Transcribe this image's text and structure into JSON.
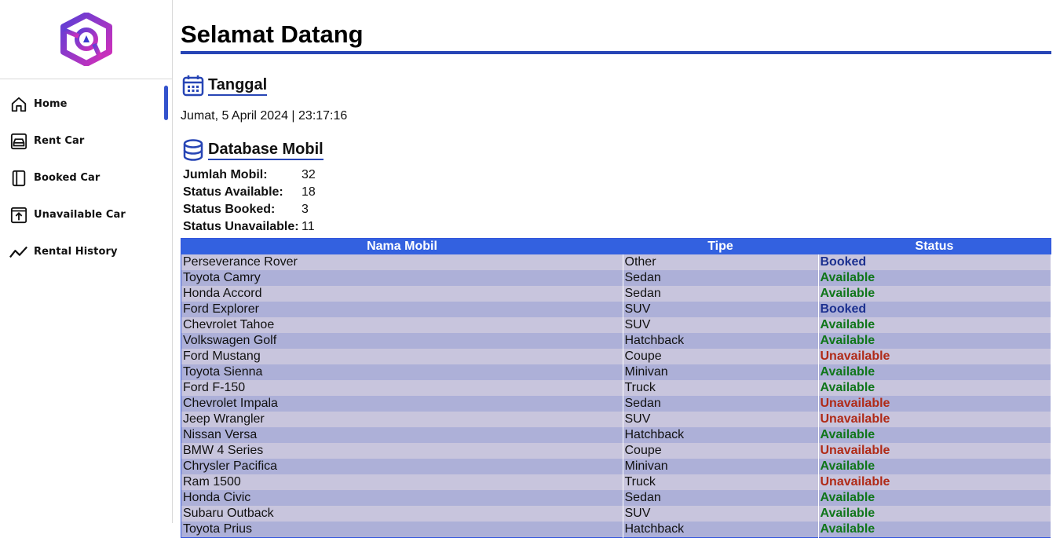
{
  "colors": {
    "accent": "#2745b5",
    "table_header": "#3361e0",
    "row_odd": "#c8c5dd",
    "row_even": "#adb0d8",
    "status_booked": "#1d3190",
    "status_available": "#10761a",
    "status_unavailable": "#b02a16"
  },
  "sidebar": {
    "logo_icon": "hexagon-logo-icon",
    "items": [
      {
        "label": "Home",
        "icon": "home-icon",
        "active": true
      },
      {
        "label": "Rent Car",
        "icon": "car-icon",
        "active": false
      },
      {
        "label": "Booked Car",
        "icon": "book-icon",
        "active": false
      },
      {
        "label": "Unavailable Car",
        "icon": "upload-box-icon",
        "active": false
      },
      {
        "label": "Rental History",
        "icon": "trend-line-icon",
        "active": false
      }
    ]
  },
  "main": {
    "title": "Selamat Datang",
    "date_section": {
      "title": "Tanggal",
      "icon": "calendar-icon",
      "value": "Jumat, 5 April 2024 | 23:17:16"
    },
    "db_section": {
      "title": "Database Mobil",
      "icon": "database-icon",
      "stats": [
        {
          "label": "Jumlah Mobil:",
          "value": "32"
        },
        {
          "label": "Status Available:",
          "value": "18"
        },
        {
          "label": "Status Booked:",
          "value": "3"
        },
        {
          "label": "Status Unavailable:",
          "value": "11"
        }
      ]
    },
    "table": {
      "headers": [
        "Nama Mobil",
        "Tipe",
        "Status"
      ],
      "rows": [
        [
          "Perseverance Rover",
          "Other",
          "Booked"
        ],
        [
          "Toyota Camry",
          "Sedan",
          "Available"
        ],
        [
          "Honda Accord",
          "Sedan",
          "Available"
        ],
        [
          "Ford Explorer",
          "SUV",
          "Booked"
        ],
        [
          "Chevrolet Tahoe",
          "SUV",
          "Available"
        ],
        [
          "Volkswagen Golf",
          "Hatchback",
          "Available"
        ],
        [
          "Ford Mustang",
          "Coupe",
          "Unavailable"
        ],
        [
          "Toyota Sienna",
          "Minivan",
          "Available"
        ],
        [
          "Ford F-150",
          "Truck",
          "Available"
        ],
        [
          "Chevrolet Impala",
          "Sedan",
          "Unavailable"
        ],
        [
          "Jeep Wrangler",
          "SUV",
          "Unavailable"
        ],
        [
          "Nissan Versa",
          "Hatchback",
          "Available"
        ],
        [
          "BMW 4 Series",
          "Coupe",
          "Unavailable"
        ],
        [
          "Chrysler Pacifica",
          "Minivan",
          "Available"
        ],
        [
          "Ram 1500",
          "Truck",
          "Unavailable"
        ],
        [
          "Honda Civic",
          "Sedan",
          "Available"
        ],
        [
          "Subaru Outback",
          "SUV",
          "Available"
        ],
        [
          "Toyota Prius",
          "Hatchback",
          "Available"
        ]
      ]
    }
  }
}
